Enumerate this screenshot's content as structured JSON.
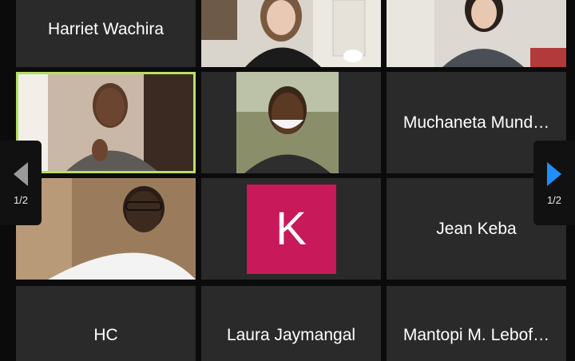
{
  "pager": {
    "prev_page_label": "1/2",
    "next_page_label": "1/2",
    "prev_arrow_color": "#9a9a9a",
    "next_arrow_color": "#1f8fff"
  },
  "participants": {
    "harriet": {
      "name": "Harriet Wachira"
    },
    "muchaneta": {
      "name": "Muchaneta Mund…"
    },
    "jean": {
      "name": "Jean Keba"
    },
    "k_avatar": {
      "initial": "K",
      "avatar_color": "#c8195a"
    },
    "hc": {
      "name": "HC"
    },
    "laura": {
      "name": "Laura Jaymangal"
    },
    "mantopi": {
      "name": "Mantopi M. Lebof…"
    }
  },
  "colors": {
    "tile_bg": "#2a2a2a",
    "active_speaker_border": "#b7e061",
    "background": "#0b0b0b"
  }
}
